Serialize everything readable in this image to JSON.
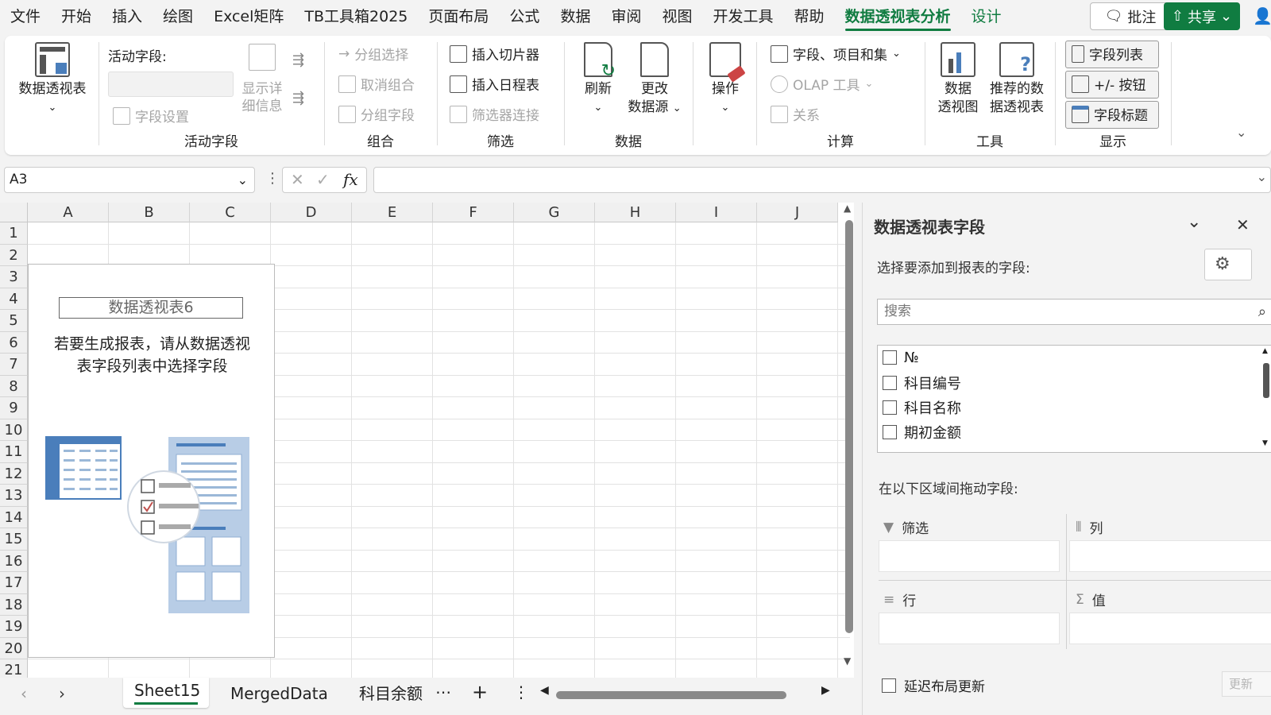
{
  "menu": {
    "tabs": [
      "文件",
      "开始",
      "插入",
      "绘图",
      "Excel矩阵",
      "TB工具箱2025",
      "页面布局",
      "公式",
      "数据",
      "审阅",
      "视图",
      "开发工具",
      "帮助",
      "数据透视表分析",
      "设计"
    ],
    "comment_label": "批注",
    "share_label": "共享"
  },
  "ribbon": {
    "pivot_label": "数据透视表",
    "active_field_label": "活动字段:",
    "field_settings": "字段设置",
    "show_details": "显示详细信息",
    "group_active_field": "活动字段",
    "group_selection": "分组选择",
    "ungroup": "取消组合",
    "group_field": "分组字段",
    "group_group": "组合",
    "insert_slicer": "插入切片器",
    "insert_timeline": "插入日程表",
    "filter_connections": "筛选器连接",
    "group_filter": "筛选",
    "refresh": "刷新",
    "change_source_1": "更改",
    "change_source_2": "数据源",
    "group_data": "数据",
    "actions": "操作",
    "fields_items_sets": "字段、项目和集",
    "olap_tools": "OLAP 工具",
    "relationships": "关系",
    "group_calc": "计算",
    "pivot_chart_1": "数据",
    "pivot_chart_2": "透视图",
    "recommended_1": "推荐的数",
    "recommended_2": "据透视表",
    "group_tools": "工具",
    "field_list": "字段列表",
    "buttons": "+/- 按钮",
    "field_headers": "字段标题",
    "group_show": "显示"
  },
  "namebox": "A3",
  "fx_label": "fx",
  "columns": [
    "A",
    "B",
    "C",
    "D",
    "E",
    "F",
    "G",
    "H",
    "I",
    "J"
  ],
  "rows": [
    "1",
    "2",
    "3",
    "4",
    "5",
    "6",
    "7",
    "8",
    "9",
    "10",
    "11",
    "12",
    "13",
    "14",
    "15",
    "16",
    "17",
    "18",
    "19",
    "20",
    "21"
  ],
  "pivot": {
    "title": "数据透视表6",
    "message_line1": "若要生成报表，请从数据透视",
    "message_line2": "表字段列表中选择字段"
  },
  "sheets": [
    "Sheet15",
    "MergedData",
    "科目余额"
  ],
  "active_sheet": "Sheet15",
  "panel": {
    "title": "数据透视表字段",
    "choose_label": "选择要添加到报表的字段:",
    "search_placeholder": "搜索",
    "fields": [
      "№",
      "科目编号",
      "科目名称",
      "期初金额"
    ],
    "drag_label": "在以下区域间拖动字段:",
    "filters": "筛选",
    "columns": "列",
    "rows": "行",
    "values": "值",
    "defer_update": "延迟布局更新",
    "update_button": "更新"
  },
  "colors": {
    "accent": "#107c41",
    "pivot_blue": "#4a7ebb"
  }
}
